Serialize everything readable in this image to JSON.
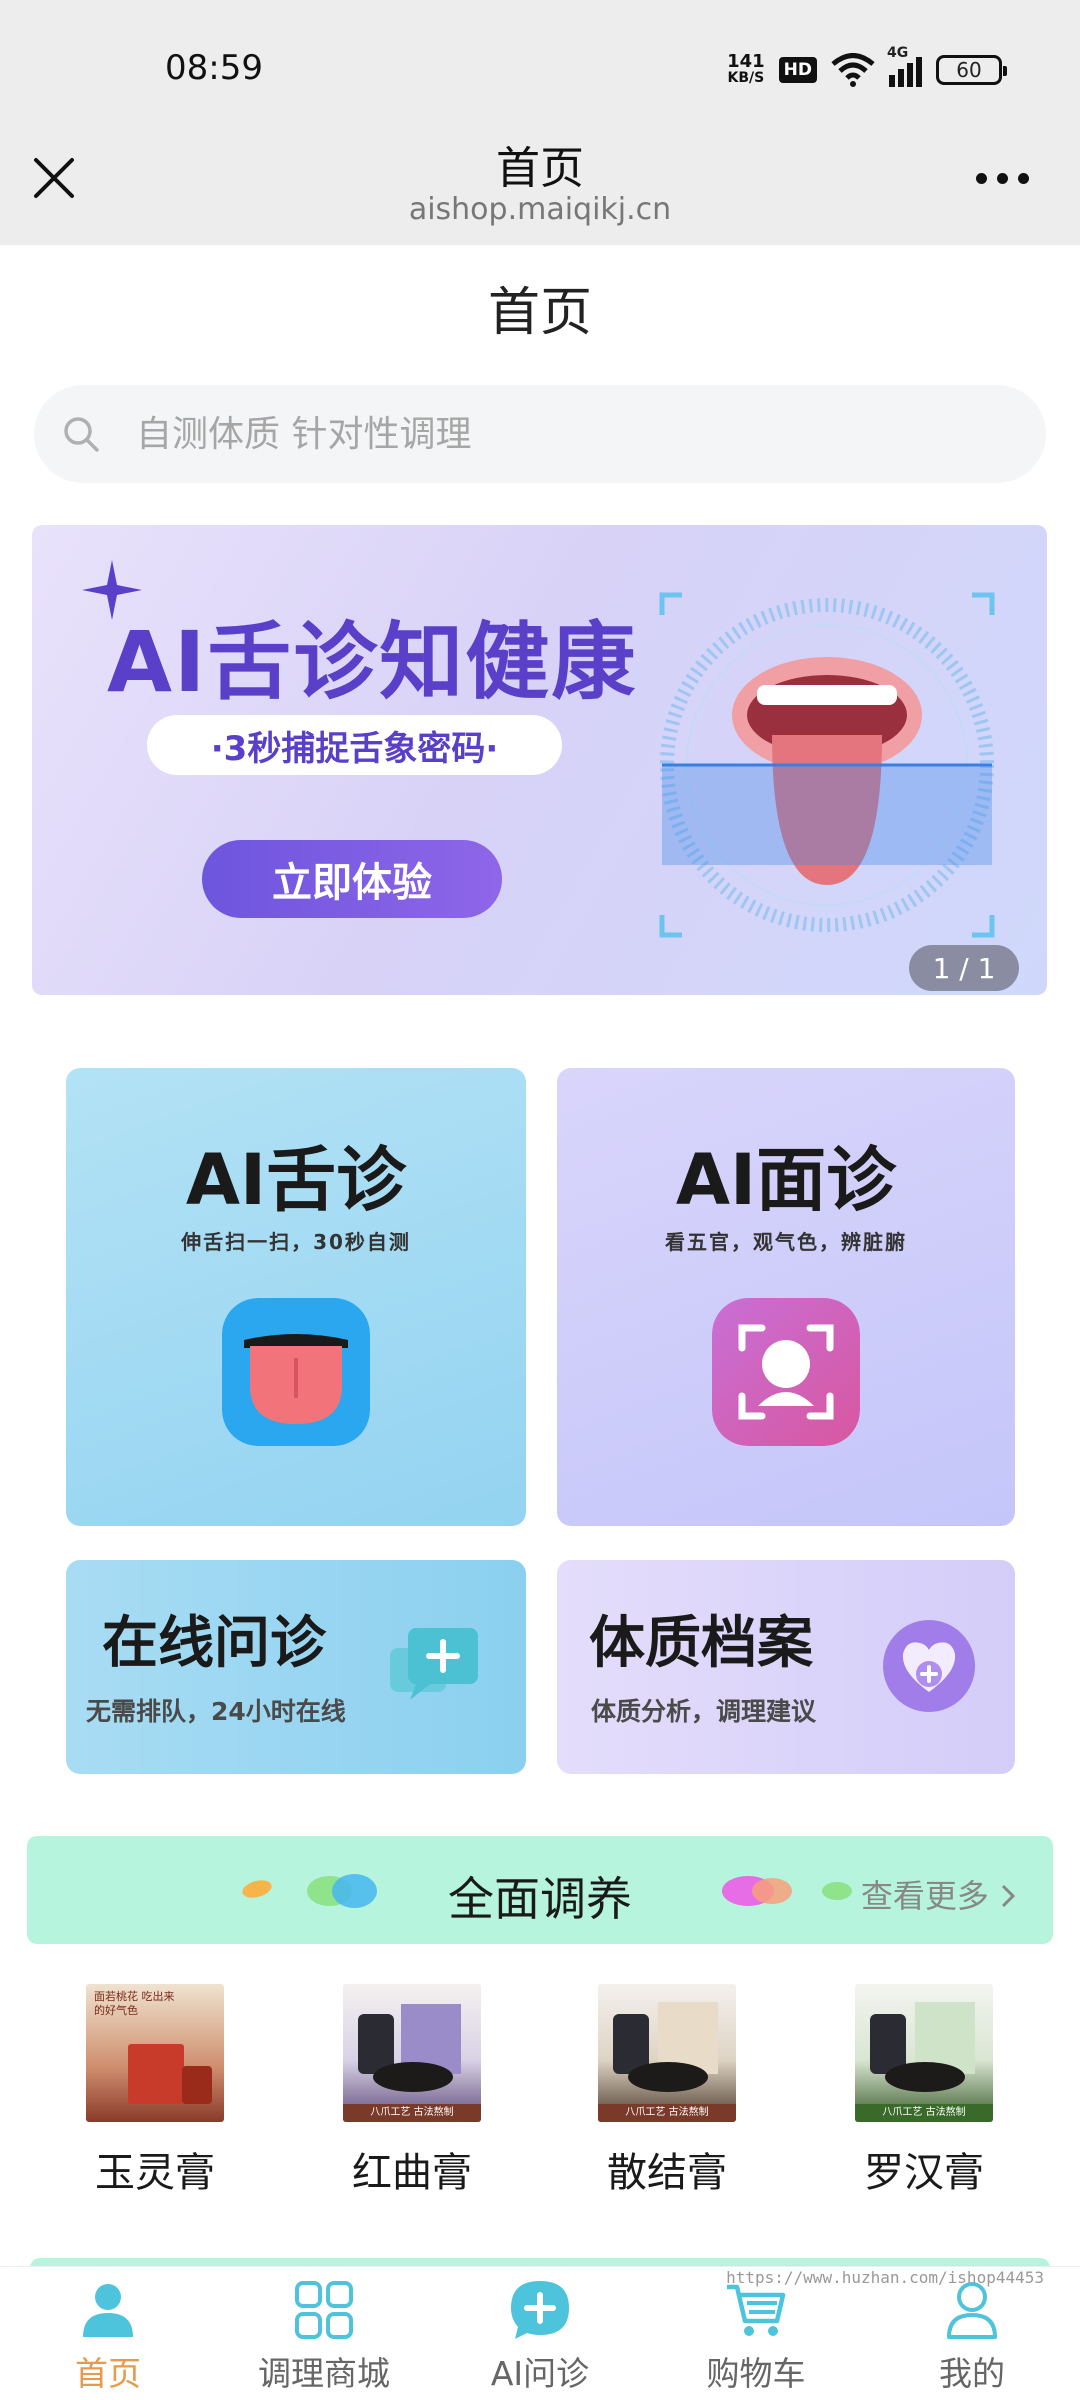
{
  "status_bar": {
    "time": "08:59",
    "net_speed_value": "141",
    "net_speed_unit": "KB/S",
    "hd": "HD",
    "signal": "4G",
    "battery": "60"
  },
  "browser": {
    "title": "首页",
    "domain": "aishop.maiqikj.cn",
    "close_icon": "close-icon",
    "more_icon": "more-icon"
  },
  "page": {
    "heading": "首页"
  },
  "search": {
    "placeholder": "自测体质 针对性调理"
  },
  "banner": {
    "title": "AI舌诊知健康",
    "subtitle": "·3秒捕捉舌象密码·",
    "cta": "立即体验",
    "counter": "1 / 1",
    "colors": {
      "accent": "#5a40c9"
    }
  },
  "features": {
    "tongue": {
      "title": "AI舌诊",
      "subtitle": "伸舌扫一扫，30秒自测",
      "icon": "tongue-icon"
    },
    "face": {
      "title": "AI面诊",
      "subtitle": "看五官，观气色，辨脏腑",
      "icon": "face-scan-icon"
    },
    "consult": {
      "title": "在线问诊",
      "subtitle": "无需排队，24小时在线",
      "icon": "chat-plus-icon"
    },
    "profile": {
      "title": "体质档案",
      "subtitle": "体质分析，调理建议",
      "icon": "heart-plus-icon"
    }
  },
  "section": {
    "title": "全面调养",
    "more": "查看更多",
    "more_icon": "chevron-right-icon"
  },
  "products": [
    {
      "name": "玉灵膏",
      "image_text": "面若桃花 吃出来的好气色"
    },
    {
      "name": "红曲膏",
      "image_text": "八爪工艺 古法熬制"
    },
    {
      "name": "散结膏",
      "image_text": "八爪工艺 古法熬制"
    },
    {
      "name": "罗汉膏",
      "image_text": "八爪工艺 古法熬制"
    }
  ],
  "watermark": "https://www.huzhan.com/ishop44453",
  "tabbar": {
    "items": [
      {
        "label": "首页",
        "icon": "home-person-icon",
        "active": true
      },
      {
        "label": "调理商城",
        "icon": "grid-icon",
        "active": false
      },
      {
        "label": "AI问诊",
        "icon": "chat-plus-icon",
        "active": false
      },
      {
        "label": "购物车",
        "icon": "cart-icon",
        "active": false
      },
      {
        "label": "我的",
        "icon": "user-icon",
        "active": false
      }
    ],
    "active_color": "#e79a4b",
    "icon_color": "#4ec3dc"
  }
}
